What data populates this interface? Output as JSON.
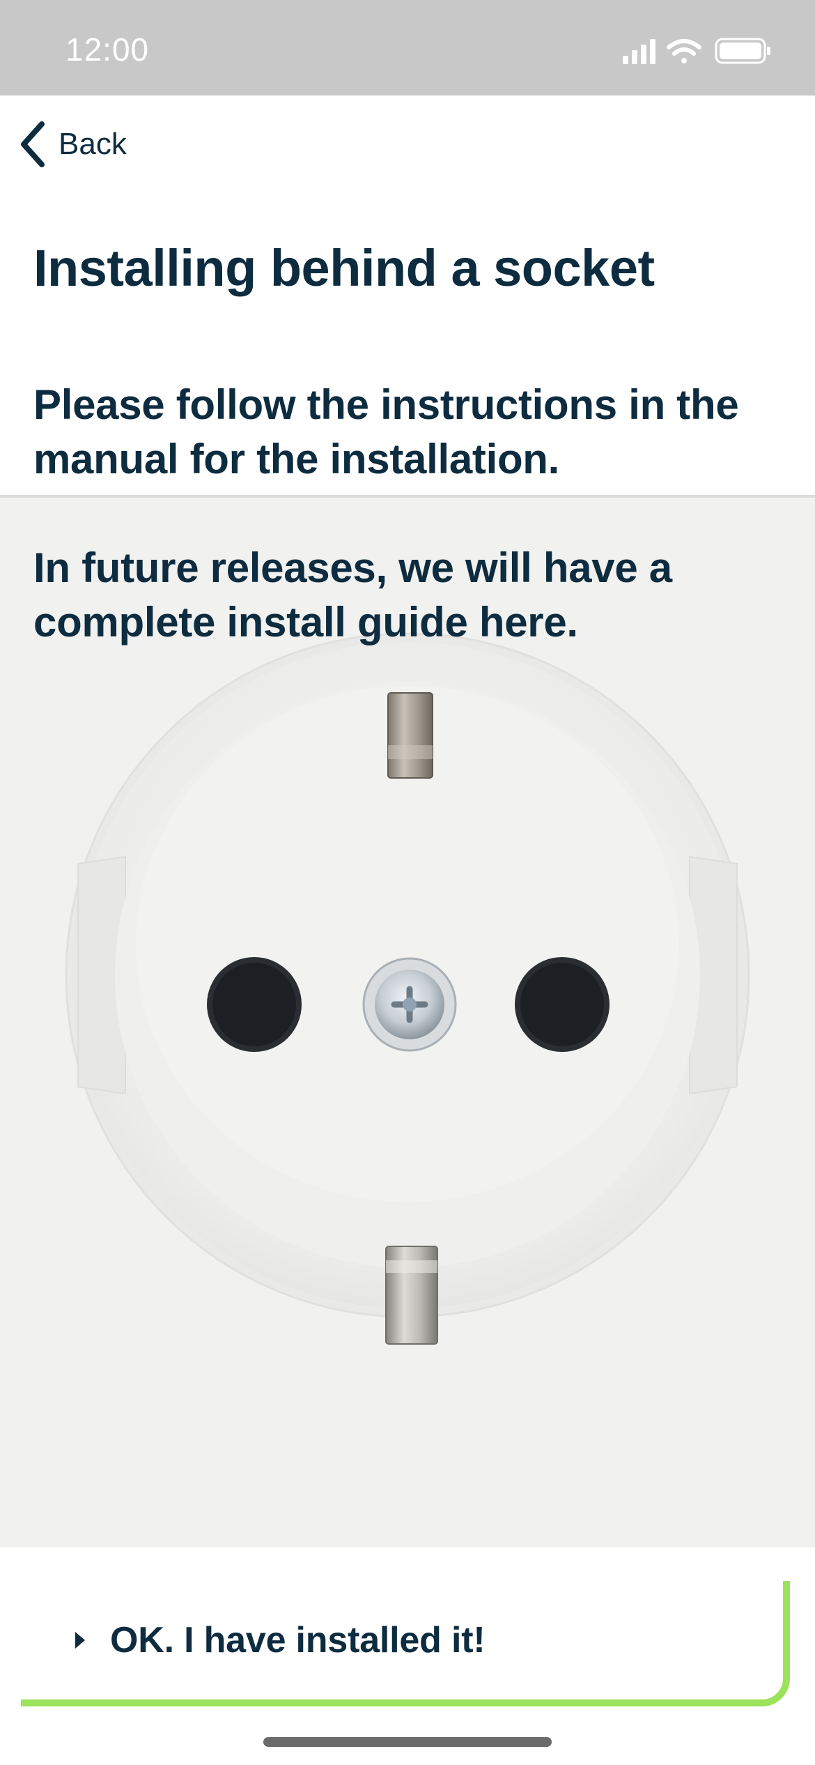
{
  "status_bar": {
    "time": "12:00",
    "icons": [
      "signal-icon",
      "wifi-icon",
      "battery-icon"
    ],
    "background": "#c8c8c8"
  },
  "nav": {
    "back_label": "Back",
    "back_icon": "chevron-left-icon"
  },
  "page": {
    "title": "Installing behind a socket",
    "instruction": "Please follow the instructions in the manual for the installation.",
    "future_note": "In future releases, we will have a complete install guide here."
  },
  "illustration": {
    "subject": "socket-image"
  },
  "confirm": {
    "label": "OK. I have installed it!",
    "icon": "caret-right-icon",
    "accent": "#9be35a"
  },
  "colors": {
    "text": "#0e2c40",
    "accent": "#9be35a"
  }
}
